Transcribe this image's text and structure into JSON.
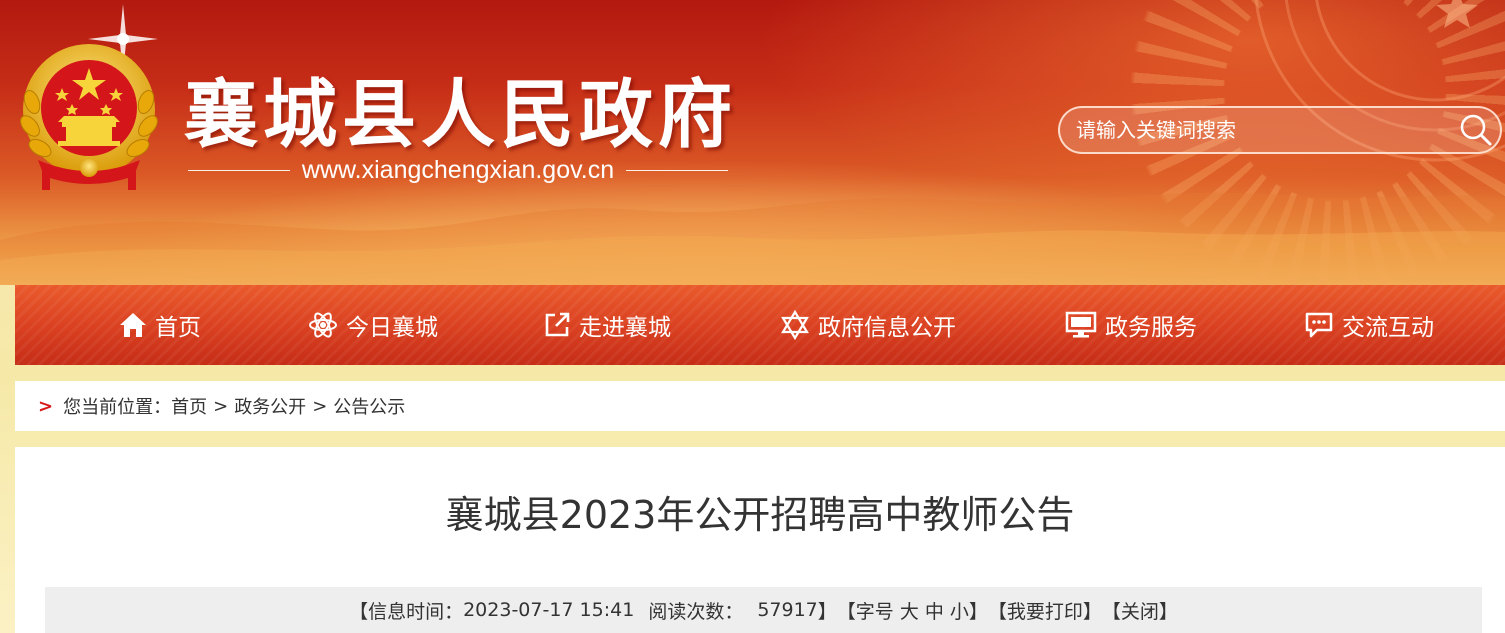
{
  "header": {
    "site_title": "襄城县人民政府",
    "site_url": "www.xiangchengxian.gov.cn",
    "search_placeholder": "请输入关键词搜索"
  },
  "nav": {
    "items": [
      {
        "label": "首页",
        "icon": "home-icon"
      },
      {
        "label": "今日襄城",
        "icon": "atom-icon"
      },
      {
        "label": "走进襄城",
        "icon": "external-link-icon"
      },
      {
        "label": "政府信息公开",
        "icon": "star-of-david-icon"
      },
      {
        "label": "政务服务",
        "icon": "monitor-icon"
      },
      {
        "label": "交流互动",
        "icon": "chat-icon"
      }
    ]
  },
  "breadcrumb": {
    "marker": ">",
    "prefix": "您当前位置：",
    "items": [
      "首页",
      "政务公开",
      "公告公示"
    ],
    "separator": ">"
  },
  "article": {
    "title": "襄城县2023年公开招聘高中教师公告",
    "meta": {
      "info_time_label": "【信息时间：",
      "info_time": "2023-07-17 15:41",
      "reads_label": "阅读次数：",
      "reads": "57917",
      "reads_close": "】",
      "font_label": "【字号",
      "font_large": "大",
      "font_medium": "中",
      "font_small": "小",
      "font_close": "】",
      "print": "【我要打印】",
      "close": "【关闭】"
    }
  },
  "colors": {
    "banner_red": "#b3190f",
    "nav_red": "#d93f20",
    "crumb_marker": "#d7191b",
    "emblem_gold": "#f5c518"
  }
}
